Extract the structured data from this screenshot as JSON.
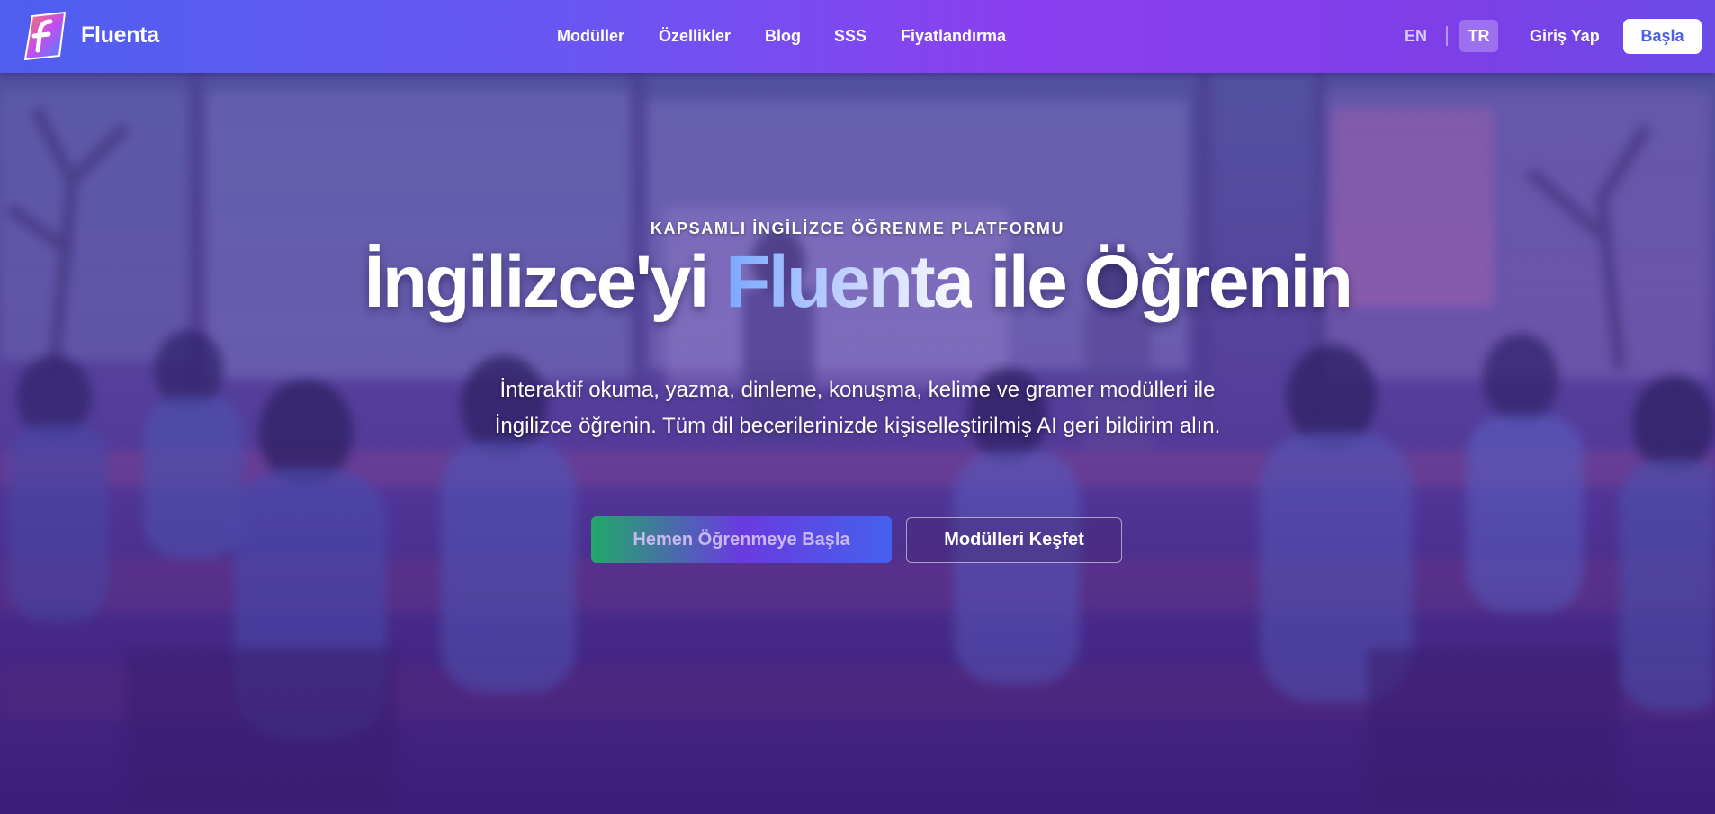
{
  "header": {
    "brand": "Fluenta",
    "logo_icon": "fluenta-logo-icon",
    "nav": [
      "Modüller",
      "Özellikler",
      "Blog",
      "SSS",
      "Fiyatlandırma"
    ],
    "lang_en": "EN",
    "lang_tr": "TR",
    "login": "Giriş Yap",
    "start": "Başla"
  },
  "hero": {
    "eyebrow": "KAPSAMLI İNGİLİZCE ÖĞRENME PLATFORMU",
    "headline_before": "İngilizce'yi ",
    "headline_accent": "Fluenta",
    "headline_after": " ile Öğrenin",
    "subtitle": "İnteraktif okuma, yazma, dinleme, konuşma, kelime ve gramer modülleri ile İngilizce öğrenin. Tüm dil becerilerinizde kişiselleştirilmiş AI geri bildirim alın.",
    "cta_primary": "Hemen Öğrenmeye Başla",
    "cta_secondary": "Modülleri Keşfet"
  },
  "colors": {
    "header_start": "#4f5ff0",
    "header_end": "#8b3ff0",
    "accent_blue": "#4a5ee8",
    "cta_green": "#22a86a"
  }
}
